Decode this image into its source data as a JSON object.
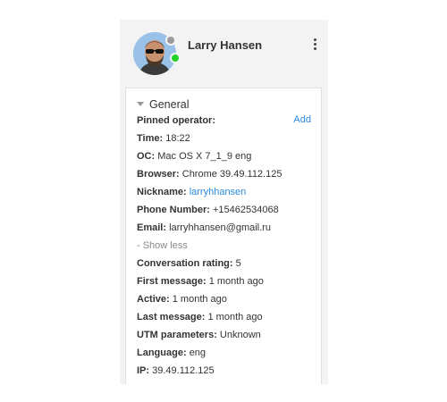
{
  "header": {
    "name": "Larry Hansen"
  },
  "general": {
    "title": "General",
    "add_label": "Add",
    "fields": [
      {
        "label": "Pinned operator:",
        "value": ""
      },
      {
        "label": "Time:",
        "value": "18:22"
      },
      {
        "label": "OC:",
        "value": "Mac OS X 7_1_9 eng"
      },
      {
        "label": "Browser:",
        "value": "Chrome 39.49.112.125"
      },
      {
        "label": "Nickname:",
        "value": "larryhhansen"
      },
      {
        "label": "Phone Number:",
        "value": "+15462534068"
      },
      {
        "label": "Email:",
        "value": "larryhhansen@gmail.ru"
      }
    ],
    "show_less": "- Show less",
    "extra_fields": [
      {
        "label": "Conversation rating:",
        "value": "5"
      },
      {
        "label": "First message:",
        "value": "1 month ago"
      },
      {
        "label": "Active:",
        "value": "1 month ago"
      },
      {
        "label": "Last message:",
        "value": "1 month ago"
      },
      {
        "label": "UTM parameters:",
        "value": "Unknown"
      },
      {
        "label": "Language:",
        "value": "eng"
      },
      {
        "label": "IP:",
        "value": "39.49.112.125"
      }
    ]
  },
  "colors": {
    "link": "#2b8be0",
    "online": "#22d22a",
    "panel_bg": "#f3f3f3"
  },
  "icons": {
    "menu": "more-vertical-icon",
    "caret": "caret-down-icon"
  }
}
